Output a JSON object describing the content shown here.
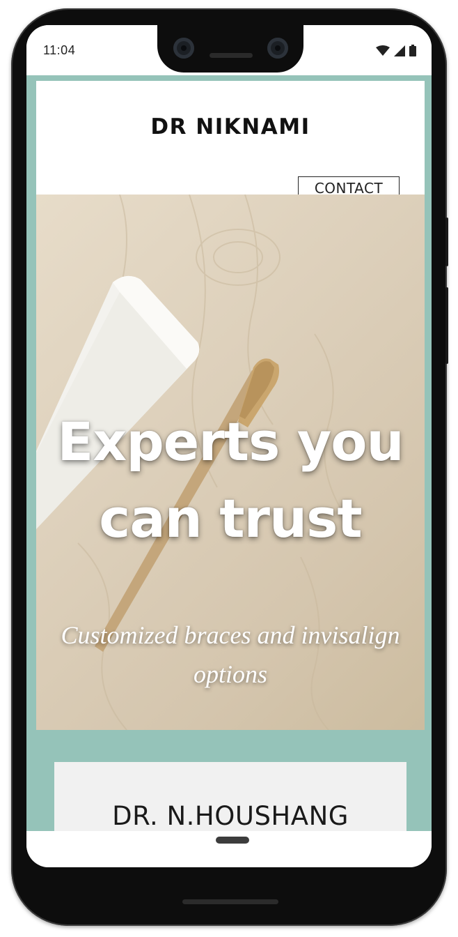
{
  "status_bar": {
    "time": "11:04",
    "icons": [
      "wifi-icon",
      "signal-icon",
      "battery-icon"
    ]
  },
  "site": {
    "brand": "DR NIKNAMI",
    "contact_label": "CONTACT",
    "hero": {
      "title": "Experts you can trust",
      "subtitle": "Customized braces and invisalign options"
    },
    "doctor": {
      "name": "DR. N.HOUSHANG"
    }
  },
  "colors": {
    "accent_teal": "#95c3b9",
    "header_bg": "#ffffff",
    "card_bg": "#f1f1f1",
    "text_dark": "#111111"
  }
}
